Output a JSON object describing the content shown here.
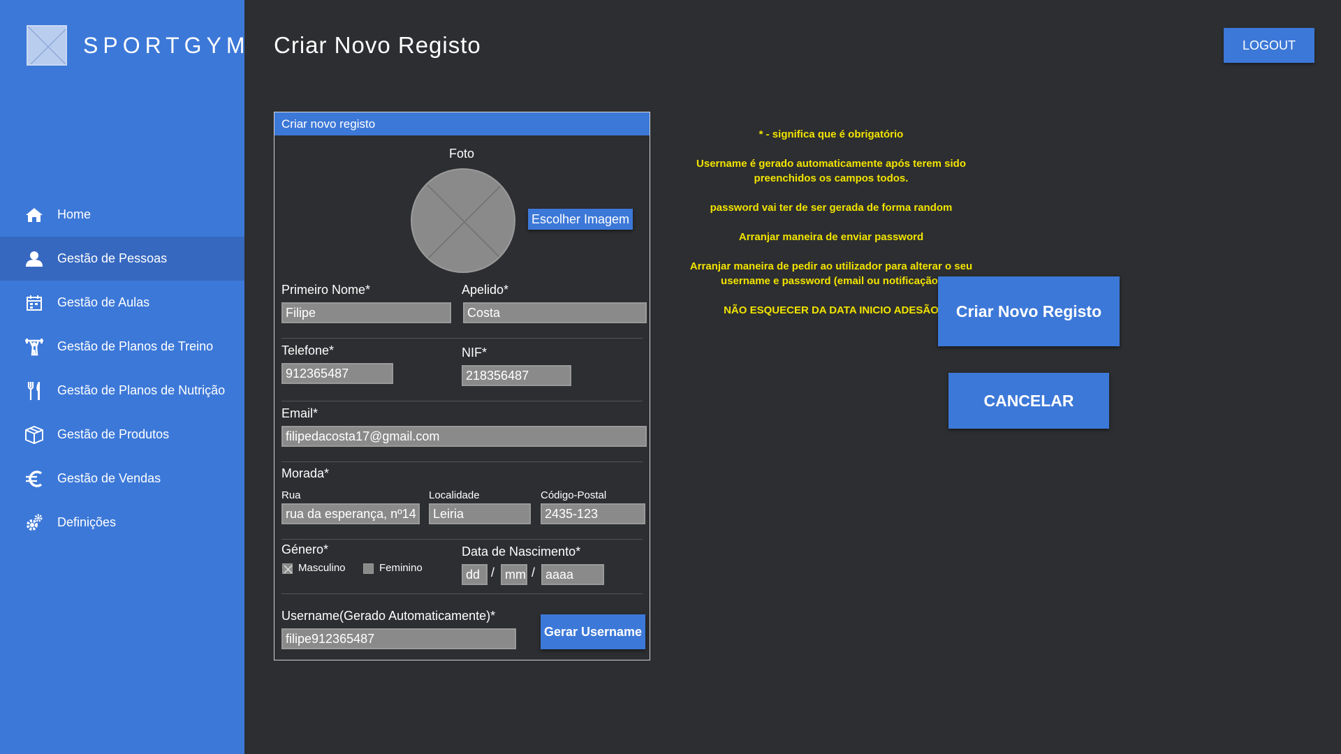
{
  "app": {
    "name": "SPORTGYM"
  },
  "sidebar": {
    "items": [
      {
        "label": "Home",
        "icon": "home-icon",
        "active": false
      },
      {
        "label": "Gestão de Pessoas",
        "icon": "person-icon",
        "active": true
      },
      {
        "label": "Gestão de Aulas",
        "icon": "calendar-icon",
        "active": false
      },
      {
        "label": "Gestão de Planos de Treino",
        "icon": "weightlifter-icon",
        "active": false
      },
      {
        "label": "Gestão de Planos de Nutrição",
        "icon": "fork-knife-icon",
        "active": false
      },
      {
        "label": "Gestão de Produtos",
        "icon": "box-icon",
        "active": false
      },
      {
        "label": "Gestão de Vendas",
        "icon": "euro-icon",
        "active": false
      },
      {
        "label": "Definições",
        "icon": "gears-icon",
        "active": false
      }
    ]
  },
  "header": {
    "title": "Criar Novo Registo",
    "logout_label": "LOGOUT"
  },
  "form": {
    "panel_title": "Criar novo registo",
    "photo_label": "Foto",
    "choose_image_label": "Escolher Imagem",
    "first_name_label": "Primeiro Nome*",
    "first_name_value": "Filipe",
    "last_name_label": "Apelido*",
    "last_name_value": "Costa",
    "phone_label": "Telefone*",
    "phone_value": "912365487",
    "nif_label": "NIF*",
    "nif_value": "218356487",
    "email_label": "Email*",
    "email_value": "filipedacosta17@gmail.com",
    "address_label": "Morada*",
    "street_label": "Rua",
    "street_value": "rua da esperança, nº14",
    "locality_label": "Localidade",
    "locality_value": "Leiria",
    "postal_label": "Código-Postal",
    "postal_value": "2435-123",
    "gender_label": "Género*",
    "gender_male": "Masculino",
    "gender_female": "Feminino",
    "gender_selected": "Masculino",
    "birth_label": "Data de Nascimento*",
    "birth_dd": "dd",
    "birth_mm": "mm",
    "birth_yyyy": "aaaa",
    "date_separator": "/",
    "username_label": "Username(Gerado Automaticamente)*",
    "username_value": "filipe912365487",
    "generate_username_label": "Gerar Username"
  },
  "notes": [
    "* - significa que é obrigatório",
    "Username é gerado automaticamente após terem sido preenchidos os campos todos.",
    "password vai ter de ser gerada de forma random",
    "Arranjar maneira de enviar password",
    "Arranjar maneira de pedir ao utilizador para alterar o seu username e password (email ou notificação)",
    "NÃO ESQUECER DA DATA INICIO ADESÃO"
  ],
  "actions": {
    "create_label": "Criar Novo Registo",
    "cancel_label": "CANCELAR"
  },
  "colors": {
    "accent": "#3c78d8",
    "background": "#2d2e31",
    "note": "#f2e400",
    "field": "#8a8a8a"
  }
}
